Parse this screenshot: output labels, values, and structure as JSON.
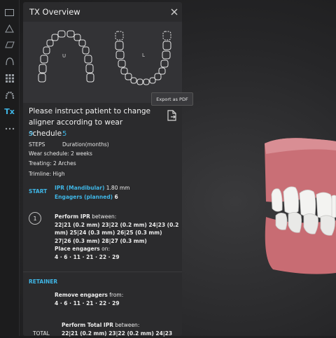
{
  "panel": {
    "title": "TX Overview",
    "upper_label": "U",
    "lower_label": "L",
    "export_tooltip": "Export as PDF",
    "instruction": "Please instruct patient to change aligner according to wear schedule",
    "steps_value": "9",
    "steps_label": "STEPS",
    "duration_value": "5",
    "duration_label": "Duration(months)",
    "wear_schedule": "Wear schedule: 2 weeks",
    "treating": "Treating: 2 Arches",
    "trimline": "Trimline: High"
  },
  "start": {
    "label": "START",
    "ipr_label": "IPR (Mandibular)",
    "ipr_value": "1.80 mm",
    "engagers_label": "Engagers (planned)",
    "engagers_value": "6"
  },
  "step1": {
    "number": "1",
    "perform_ipr": "Perform IPR",
    "between": " between:",
    "ipr_line1": "22|21 (0.2 mm) 23|22 (0.2 mm) 24|23 (0.2",
    "ipr_line2": "mm) 25|24 (0.3 mm) 26|25 (0.3 mm)",
    "ipr_line3": "27|26 (0.3 mm) 28|27 (0.3 mm)",
    "place_engagers": "Place engagers",
    "on": " on:",
    "engagers_list": "4 · 6 · 11 · 21 · 22 · 29"
  },
  "retainer": {
    "label": "RETAINER",
    "remove_engagers": "Remove engagers",
    "from": " from:",
    "engagers_list": "4 · 6 · 11 · 21 · 22 · 29"
  },
  "total": {
    "label": "TOTAL",
    "perform_total_ipr": "Perform Total IPR",
    "between": " between:",
    "ipr_line1": "22|21 (0.2 mm) 23|22 (0.2 mm) 24|23"
  },
  "toolbar": {
    "tx_label": "Tx",
    "icons": [
      "rectangle-icon",
      "triangle-icon",
      "parallelogram-icon",
      "arch-icon",
      "grid-icon",
      "tooth-arch-icon",
      "tx-icon",
      "more-icon"
    ]
  },
  "colors": {
    "accent": "#3fb6e6",
    "panel_bg": "#2b2b2d",
    "gum": "#c9747a",
    "tooth": "#f2f2f0"
  }
}
